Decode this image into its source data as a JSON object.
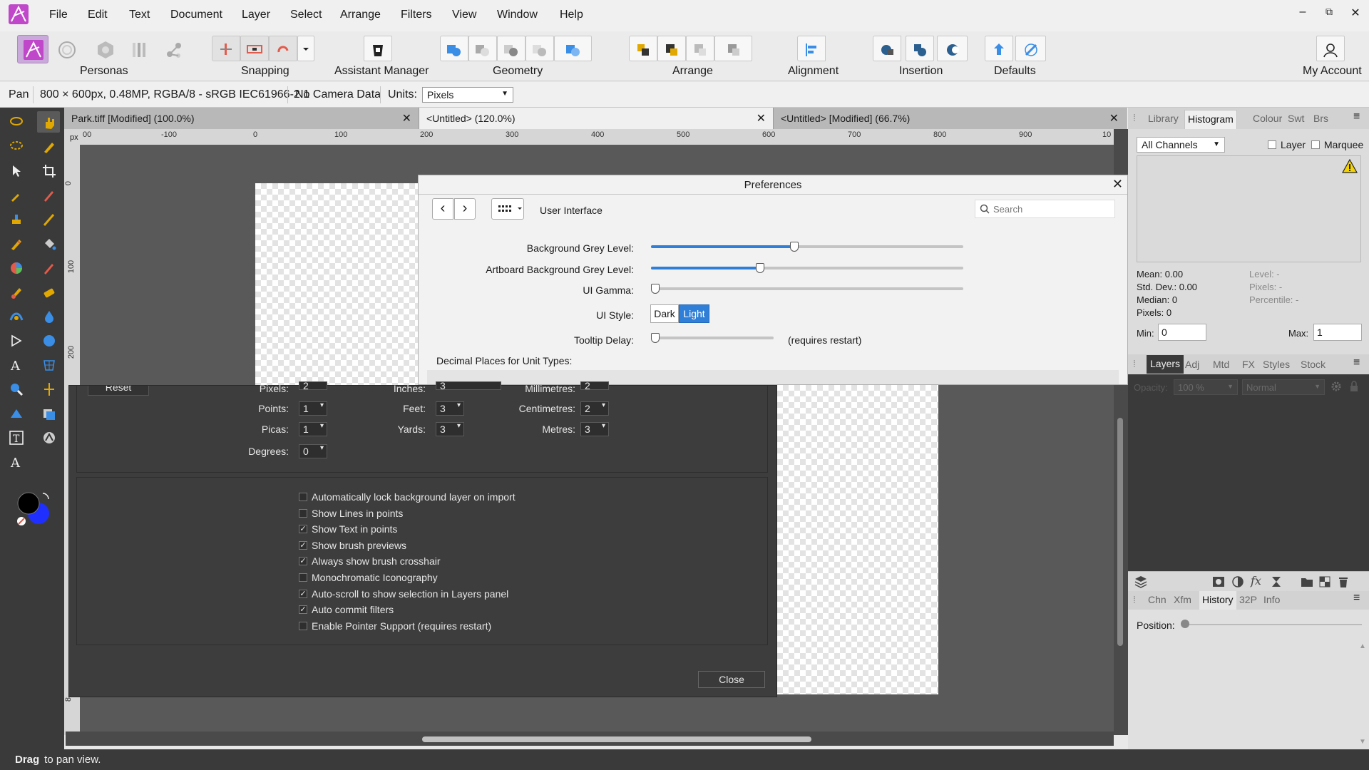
{
  "menu": {
    "items": [
      "File",
      "Edit",
      "Text",
      "Document",
      "Layer",
      "Select",
      "Arrange",
      "Filters",
      "View",
      "Window",
      "Help"
    ]
  },
  "window_controls": {
    "minimize": "–",
    "restore": "⧉",
    "close": "✕"
  },
  "toolbar": {
    "personas": "Personas",
    "snapping": "Snapping",
    "assistant": "Assistant Manager",
    "geometry": "Geometry",
    "arrange": "Arrange",
    "alignment": "Alignment",
    "insertion": "Insertion",
    "defaults": "Defaults",
    "account": "My Account"
  },
  "context": {
    "tool": "Pan",
    "doc_info": "800 × 600px, 0.48MP, RGBA/8 - sRGB IEC61966-2.1",
    "camera": "No Camera Data",
    "units_label": "Units:",
    "units_value": "Pixels"
  },
  "tabs": [
    {
      "label": "Park.tiff [Modified] (100.0%)"
    },
    {
      "label": "<Untitled> (120.0%)"
    },
    {
      "label": "<Untitled> [Modified] (66.7%)"
    }
  ],
  "rulers": {
    "unit": "px",
    "top": [
      "00",
      "-100",
      "0",
      "100",
      "200",
      "300",
      "400",
      "500",
      "600",
      "700",
      "800",
      "900",
      "10"
    ],
    "left": [
      "0",
      "100",
      "200",
      "8"
    ]
  },
  "prefs": {
    "title": "Preferences",
    "section": "User Interface",
    "search_placeholder": "Search",
    "bg_grey_label": "Background Grey Level:",
    "bg_grey_value": 0.46,
    "artboard_grey_label": "Artboard Background Grey Level:",
    "artboard_grey_value": 0.35,
    "gamma_label": "UI Gamma:",
    "gamma_value": 0.0,
    "style_label": "UI Style:",
    "style_dark": "Dark",
    "style_light": "Light",
    "style_selected": "Light",
    "tooltip_label": "Tooltip Delay:",
    "tooltip_value": 0.0,
    "tooltip_note": "(requires restart)",
    "decimal_label": "Decimal Places for Unit Types:",
    "reset": "Reset",
    "units": {
      "pixels": {
        "label": "Pixels:",
        "value": "2"
      },
      "inches": {
        "label": "Inches:",
        "value": "3"
      },
      "millimetres": {
        "label": "Millimetres:",
        "value": "2"
      },
      "points": {
        "label": "Points:",
        "value": "1"
      },
      "feet": {
        "label": "Feet:",
        "value": "3"
      },
      "centimetres": {
        "label": "Centimetres:",
        "value": "2"
      },
      "picas": {
        "label": "Picas:",
        "value": "1"
      },
      "yards": {
        "label": "Yards:",
        "value": "3"
      },
      "metres": {
        "label": "Metres:",
        "value": "3"
      },
      "degrees": {
        "label": "Degrees:",
        "value": "0"
      }
    },
    "options": [
      {
        "label": "Automatically lock background layer on import",
        "checked": false
      },
      {
        "label": "Show Lines in points",
        "checked": false
      },
      {
        "label": "Show Text in points",
        "checked": true
      },
      {
        "label": "Show brush previews",
        "checked": true
      },
      {
        "label": "Always show brush crosshair",
        "checked": true
      },
      {
        "label": "Monochromatic Iconography",
        "checked": false
      },
      {
        "label": "Auto-scroll to show selection in Layers panel",
        "checked": true
      },
      {
        "label": "Auto commit filters",
        "checked": true
      },
      {
        "label": "Enable Pointer Support (requires restart)",
        "checked": false
      }
    ],
    "check_mark": "✓",
    "close": "Close"
  },
  "panel_top": {
    "tabs": [
      "Library",
      "Histogram",
      "Colour",
      "Swt",
      "Brs"
    ],
    "active": "Histogram",
    "channels": "All Channels",
    "layer": "Layer",
    "marquee": "Marquee",
    "stats_left": [
      "Mean: 0.00",
      "Std. Dev.: 0.00",
      "Median: 0",
      "Pixels: 0"
    ],
    "stats_right": [
      "Level: -",
      "Pixels: -",
      "Percentile: -"
    ],
    "min_label": "Min:",
    "min_value": "0",
    "max_label": "Max:",
    "max_value": "1"
  },
  "panel_layers": {
    "tabs": [
      "Layers",
      "Adj",
      "Mtd",
      "FX",
      "Styles",
      "Stock"
    ],
    "active": "Layers",
    "opacity_label": "Opacity:",
    "opacity": "100 %",
    "blend": "Normal"
  },
  "panel_history": {
    "tabs": [
      "Chn",
      "Xfm",
      "History",
      "32P",
      "Info"
    ],
    "active": "History",
    "position_label": "Position:"
  },
  "status": {
    "bold": "Drag",
    "rest": " to pan view."
  },
  "colors": {
    "accent": "#2f7fd8",
    "dark_panel": "#3d3d3d",
    "fg_color": "#000000",
    "bg_color": "#1f2fff",
    "app_brand": "#c047c9"
  }
}
